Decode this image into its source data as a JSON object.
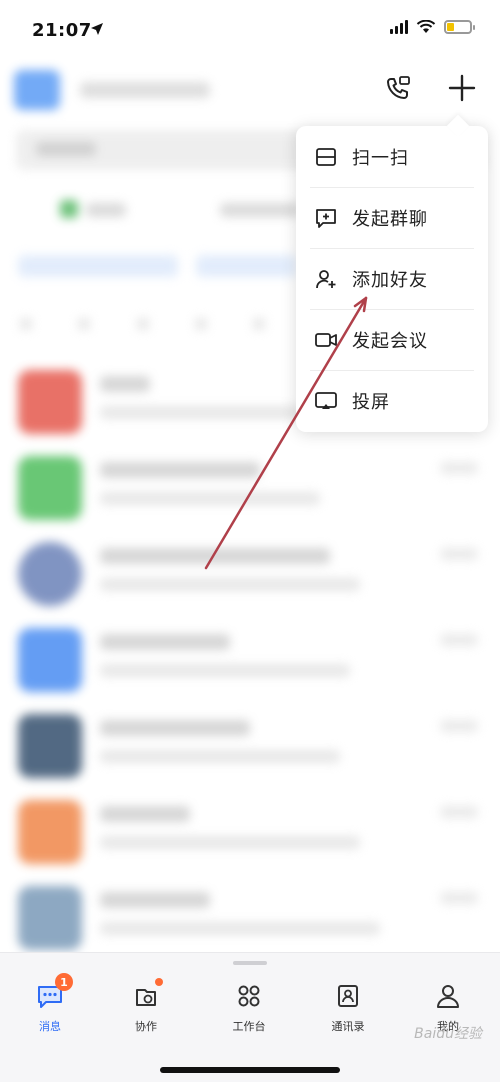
{
  "status": {
    "time": "21:07"
  },
  "menu": {
    "items": [
      {
        "label": "扫一扫",
        "icon": "scan-icon"
      },
      {
        "label": "发起群聊",
        "icon": "group-chat-icon"
      },
      {
        "label": "添加好友",
        "icon": "add-friend-icon"
      },
      {
        "label": "发起会议",
        "icon": "video-meeting-icon"
      },
      {
        "label": "投屏",
        "icon": "screen-cast-icon"
      }
    ]
  },
  "tabbar": {
    "tabs": [
      {
        "label": "消息",
        "icon": "message-icon",
        "active": true,
        "badge": "1"
      },
      {
        "label": "协作",
        "icon": "collaborate-icon",
        "active": false
      },
      {
        "label": "工作台",
        "icon": "workbench-icon",
        "active": false
      },
      {
        "label": "通讯录",
        "icon": "contacts-icon",
        "active": false
      },
      {
        "label": "我的",
        "icon": "profile-icon",
        "active": false
      }
    ]
  },
  "watermark": "Baidu经验",
  "colors": {
    "accent": "#2f6cf5",
    "badge": "#ff6b35",
    "annotation_arrow": "#b0404a"
  }
}
